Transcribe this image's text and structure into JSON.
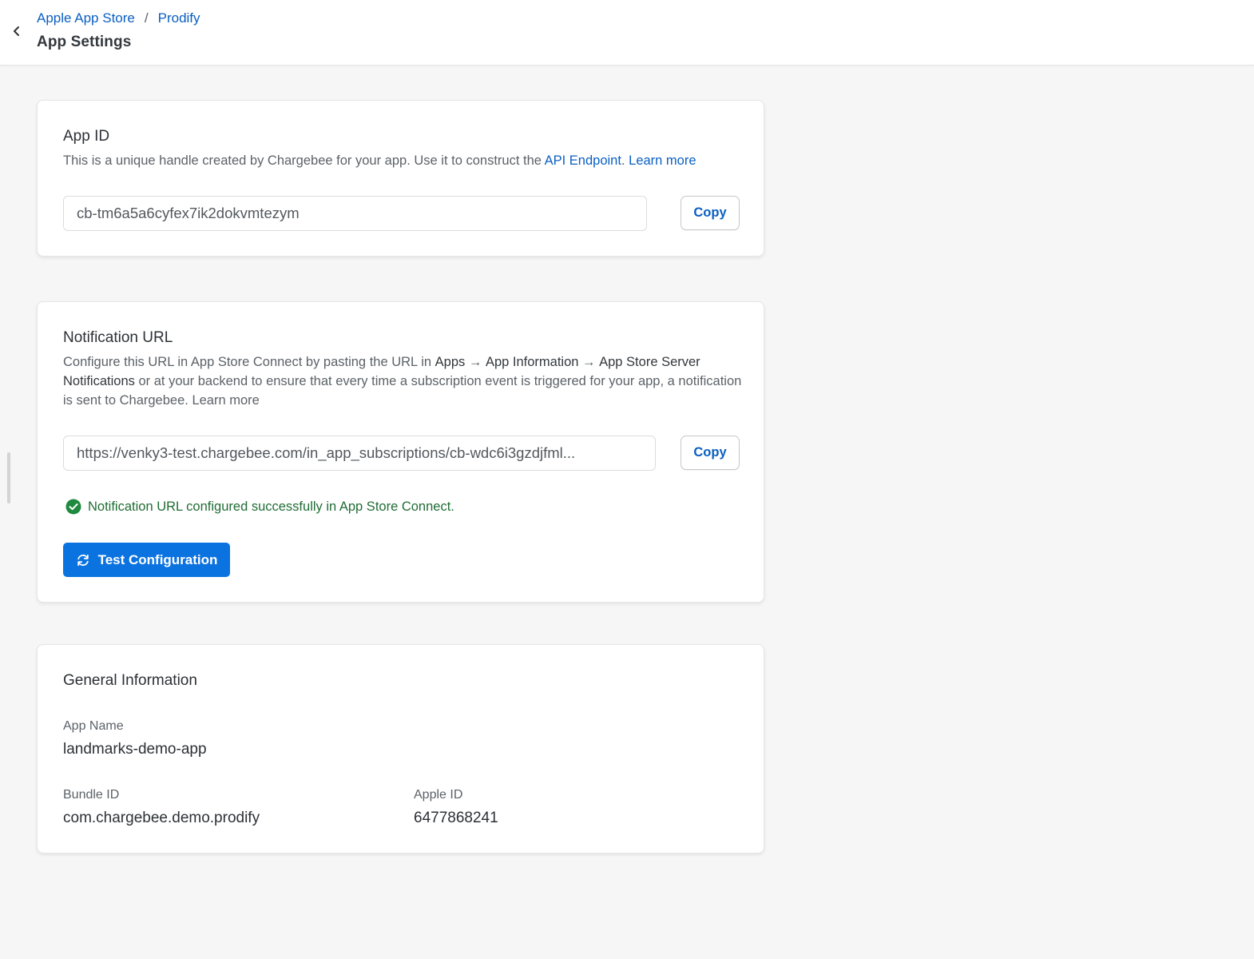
{
  "header": {
    "breadcrumb": [
      "Apple App Store",
      "Prodify"
    ],
    "breadcrumb_separator": "/",
    "title": "App Settings",
    "back_icon": "chevron-left-icon"
  },
  "app_id_card": {
    "title": "App ID",
    "description_prefix": "This is a unique handle created by Chargebee for your app. Use it to construct the",
    "api_endpoint_link": "API Endpoint",
    "description_suffix": ".",
    "learn_more": "Learn more",
    "value": "cb-tm6a5a6cyfex7ik2dokvmtezym",
    "copy_label": "Copy"
  },
  "notification_card": {
    "title": "Notification URL",
    "desc_1": "Configure this URL in App Store Connect by pasting the URL in",
    "path_apps": "Apps",
    "arrow": "→",
    "path_app_info": "App Information",
    "path_server_notifications": "App Store Server Notifications",
    "desc_2": "or at your backend to ensure that every time a subscription event is triggered for your app, a notification is sent to Chargebee.",
    "learn_more": "Learn more",
    "value": "https://venky3-test.chargebee.com/in_app_subscriptions/cb-wdc6i3gzdjfml...",
    "copy_label": "Copy",
    "success_message": "Notification URL configured successfully in App Store Connect.",
    "test_button_label": "Test Configuration"
  },
  "general_info": {
    "title": "General Information",
    "app_name_label": "App Name",
    "app_name_value": "landmarks-demo-app",
    "bundle_id_label": "Bundle ID",
    "bundle_id_value": "com.chargebee.demo.prodify",
    "apple_id_label": "Apple ID",
    "apple_id_value": "6477868241"
  },
  "colors": {
    "link": "#0a5fc2",
    "primary": "#0b73e0",
    "success": "#1f8a3f",
    "background": "#f6f6f6"
  }
}
